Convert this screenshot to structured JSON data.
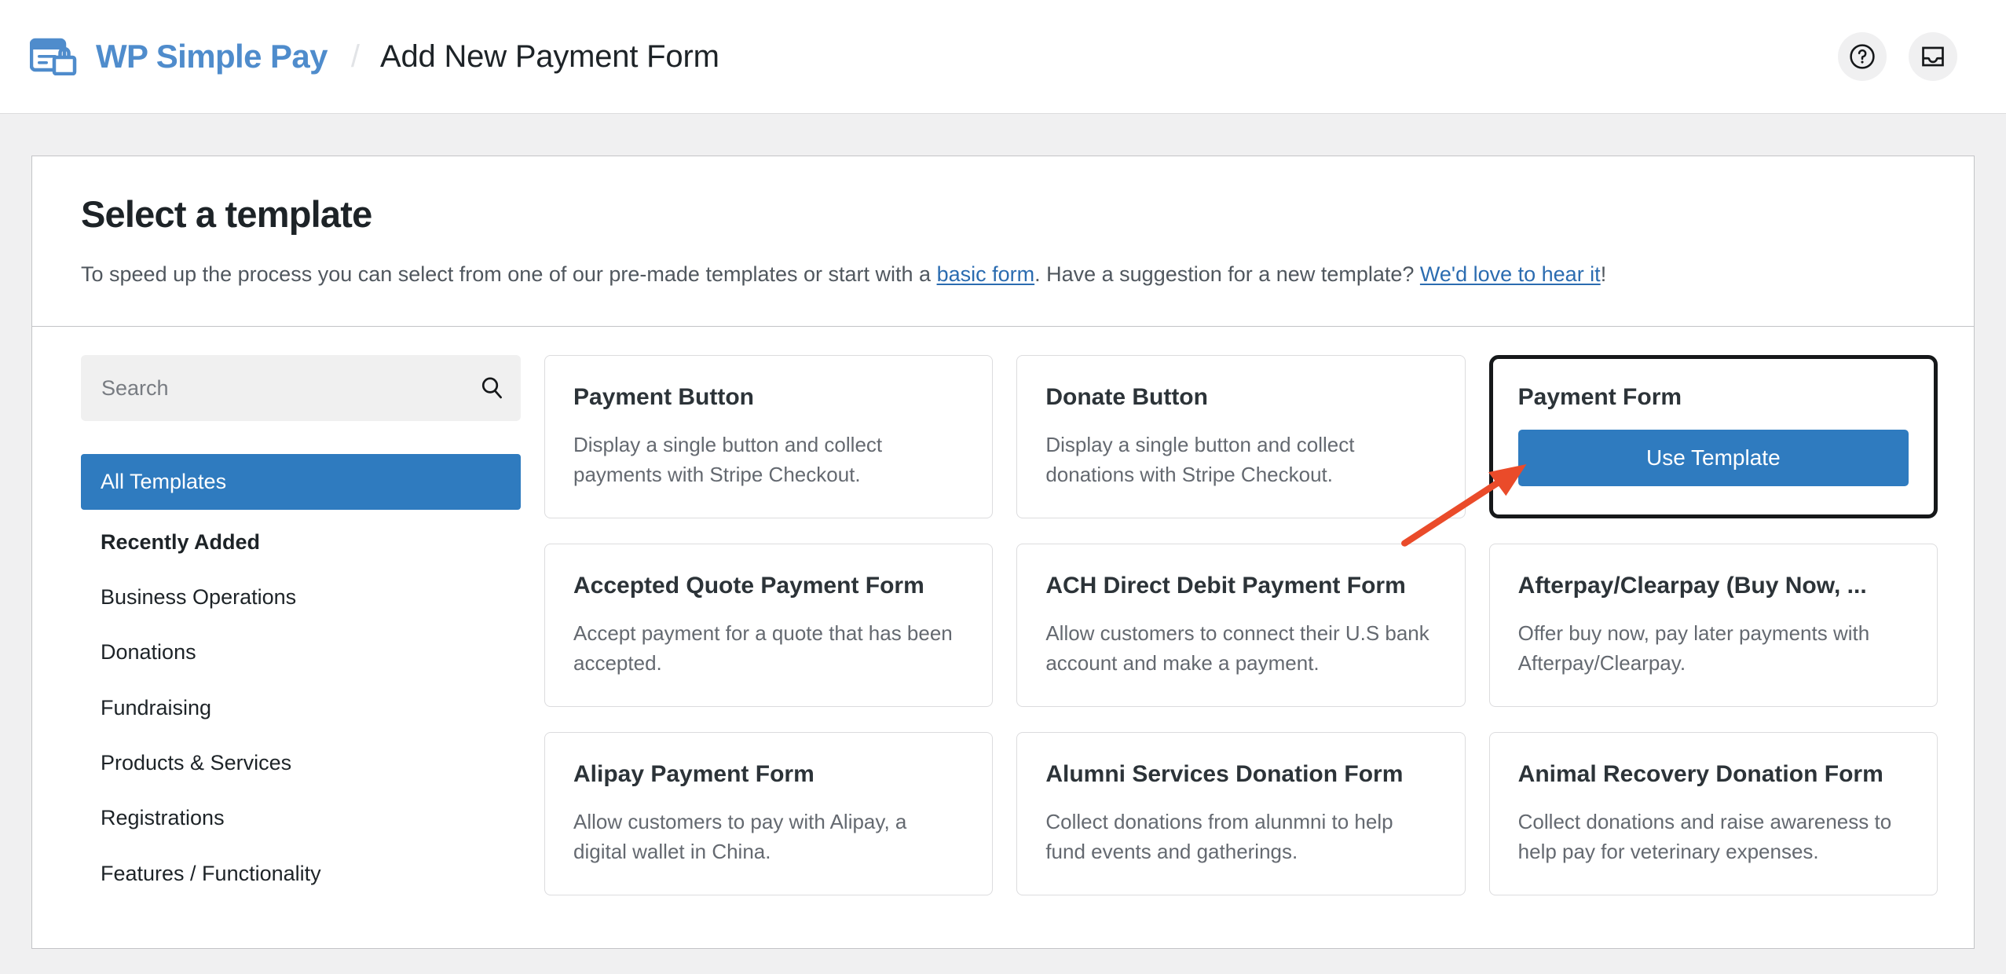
{
  "topbar": {
    "brand_name": "WP Simple Pay",
    "brand_logo_icon": "card-lock-icon",
    "separator": "/",
    "page_title": "Add New Payment Form",
    "help_button_label": "help-circle-icon",
    "inbox_button_label": "inbox-icon"
  },
  "panel": {
    "title": "Select a template",
    "description_part1": "To speed up the process you can select from one of our pre-made templates or start with a ",
    "link_basic_form": "basic form",
    "description_part2": ". Have a suggestion for a new template? ",
    "link_feedback": "We'd love to hear it",
    "description_part3": "!"
  },
  "search": {
    "placeholder": "Search",
    "value": "",
    "icon": "search-icon"
  },
  "categories": [
    {
      "label": "All Templates",
      "active": true,
      "bold": false
    },
    {
      "label": "Recently Added",
      "active": false,
      "bold": true
    },
    {
      "label": "Business Operations",
      "active": false,
      "bold": false
    },
    {
      "label": "Donations",
      "active": false,
      "bold": false
    },
    {
      "label": "Fundraising",
      "active": false,
      "bold": false
    },
    {
      "label": "Products & Services",
      "active": false,
      "bold": false
    },
    {
      "label": "Registrations",
      "active": false,
      "bold": false
    },
    {
      "label": "Features / Functionality",
      "active": false,
      "bold": false
    }
  ],
  "templates": [
    {
      "title": "Payment Button",
      "description": "Display a single button and collect payments with Stripe Checkout.",
      "selected": false
    },
    {
      "title": "Donate Button",
      "description": "Display a single button and collect donations with Stripe Checkout.",
      "selected": false
    },
    {
      "title": "Payment Form",
      "description": "",
      "selected": true,
      "button_label": "Use Template"
    },
    {
      "title": "Accepted Quote Payment Form",
      "description": "Accept payment for a quote that has been accepted.",
      "selected": false
    },
    {
      "title": "ACH Direct Debit Payment Form",
      "description": "Allow customers to connect their U.S bank account and make a payment.",
      "selected": false
    },
    {
      "title": "Afterpay/Clearpay (Buy Now, ...",
      "description": "Offer buy now, pay later payments with Afterpay/Clearpay.",
      "selected": false
    },
    {
      "title": "Alipay Payment Form",
      "description": "Allow customers to pay with Alipay, a digital wallet in China.",
      "selected": false
    },
    {
      "title": "Alumni Services Donation Form",
      "description": "Collect donations from alunmni to help fund events and gatherings.",
      "selected": false
    },
    {
      "title": "Animal Recovery Donation Form",
      "description": "Collect donations and raise awareness to help pay for veterinary expenses.",
      "selected": false
    }
  ],
  "annotation": {
    "type": "arrow",
    "color": "#ea4b2a",
    "points_to": "use-template-button"
  },
  "colors": {
    "brand_blue": "#4f8ccc",
    "accent_blue": "#2f7bbf",
    "link_blue": "#2b6cb0",
    "page_background": "#f0f0f1",
    "annotation_red": "#ea4b2a"
  }
}
